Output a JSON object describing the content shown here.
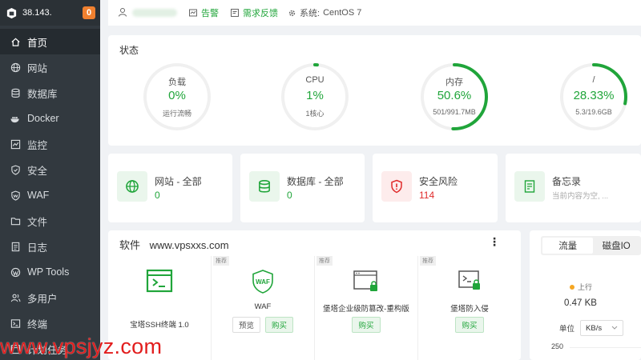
{
  "sidebar": {
    "ip": "38.143.",
    "badge": "0",
    "items": [
      {
        "label": "首页",
        "icon": "home-icon",
        "active": true
      },
      {
        "label": "网站",
        "icon": "globe-icon"
      },
      {
        "label": "数据库",
        "icon": "database-icon"
      },
      {
        "label": "Docker",
        "icon": "docker-icon"
      },
      {
        "label": "监控",
        "icon": "monitor-icon"
      },
      {
        "label": "安全",
        "icon": "shield-icon"
      },
      {
        "label": "WAF",
        "icon": "waf-icon"
      },
      {
        "label": "文件",
        "icon": "folder-icon"
      },
      {
        "label": "日志",
        "icon": "log-icon"
      },
      {
        "label": "WP Tools",
        "icon": "wordpress-icon"
      },
      {
        "label": "多用户",
        "icon": "users-icon"
      },
      {
        "label": "终端",
        "icon": "terminal-icon"
      },
      {
        "label": "计划任务",
        "icon": "clock-icon"
      }
    ]
  },
  "topbar": {
    "alert_label": "告警",
    "feedback_label": "需求反馈",
    "system_label": "系统:",
    "system_value": "CentOS 7"
  },
  "status": {
    "title": "状态",
    "gauges": [
      {
        "label": "负载",
        "value": "0%",
        "sub": "运行流畅",
        "fraction": 0.0
      },
      {
        "label": "CPU",
        "value": "1%",
        "sub": "1核心",
        "fraction": 0.01
      },
      {
        "label": "内存",
        "value": "50.6%",
        "sub": "501/991.7MB",
        "fraction": 0.506
      },
      {
        "label": "/",
        "value": "28.33%",
        "sub": "5.3/19.6GB",
        "fraction": 0.2833
      }
    ]
  },
  "info_cards": [
    {
      "label": "网站 - 全部",
      "value": "0",
      "icon": "globe-icon",
      "value_color": "#20a53a"
    },
    {
      "label": "数据库 - 全部",
      "value": "0",
      "icon": "database-icon",
      "value_color": "#20a53a"
    },
    {
      "label": "安全风险",
      "value": "114",
      "icon": "shield-alert-icon",
      "value_color": "#e02b2b"
    },
    {
      "label": "备忘录",
      "value": "当前内容为空, ...",
      "icon": "memo-icon",
      "value_color": "#aaaaaa"
    }
  ],
  "software": {
    "title": "软件",
    "site": "www.vpsxxs.com",
    "recommend_tag": "推荐",
    "items": [
      {
        "name": "宝塔SSH终端 1.0",
        "buttons": [],
        "tagged": false
      },
      {
        "name": "WAF",
        "buttons": [
          "预览",
          "购买"
        ],
        "tagged": true
      },
      {
        "name": "堡塔企业级防篡改-重构版",
        "buttons": [
          "购买"
        ],
        "tagged": true
      },
      {
        "name": "堡塔防入侵",
        "buttons": [
          "购买"
        ],
        "tagged": true
      }
    ]
  },
  "traffic": {
    "tabs": [
      "流量",
      "磁盘IO"
    ],
    "legend": "上行",
    "value": "0.47 KB",
    "unit_label": "单位",
    "unit_value": "KB/s",
    "y_tick": "250"
  },
  "watermark": "www.vpsjyz.com",
  "colors": {
    "accent": "#20a53a",
    "danger": "#e02b2b",
    "sidebar": "#32393f"
  }
}
